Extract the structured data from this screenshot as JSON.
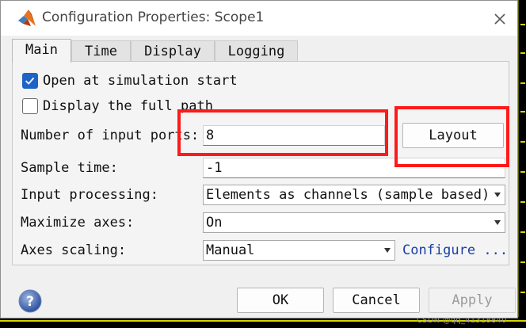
{
  "window": {
    "title": "Configuration Properties: Scope1",
    "app_icon": "matlab-logo-icon",
    "close_icon": "close-icon"
  },
  "tabs": [
    {
      "label": "Main",
      "active": true
    },
    {
      "label": "Time",
      "active": false
    },
    {
      "label": "Display",
      "active": false
    },
    {
      "label": "Logging",
      "active": false
    }
  ],
  "main": {
    "open_at_start": {
      "label": "Open at simulation start",
      "checked": true
    },
    "display_full_path": {
      "label": "Display the full path",
      "checked": false
    },
    "input_ports": {
      "label": "Number of input ports:",
      "value": "8"
    },
    "layout_button": "Layout",
    "sample_time": {
      "label": "Sample time:",
      "value": "-1"
    },
    "input_processing": {
      "label": "Input processing:",
      "value": "Elements as channels (sample based)"
    },
    "maximize_axes": {
      "label": "Maximize axes:",
      "value": "On"
    },
    "axes_scaling": {
      "label": "Axes scaling:",
      "value": "Manual",
      "link": "Configure ..."
    }
  },
  "footer": {
    "help_icon": "help-icon",
    "ok": "OK",
    "cancel": "Cancel",
    "apply": "Apply"
  },
  "watermark": "CSDN @qq_41318840",
  "colors": {
    "checkbox_accent": "#1f63c6",
    "annotation_red": "#ff1a1a",
    "link": "#1a3fa3",
    "scope_trace": "#d6d600"
  }
}
